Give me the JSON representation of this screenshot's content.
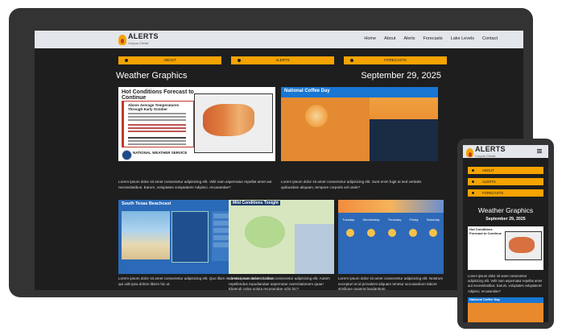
{
  "site": {
    "logo_title": "ALERTS",
    "logo_subtitle": "Corpus Christi",
    "nav": [
      "Home",
      "About",
      "Alerts",
      "Forecasts",
      "Lake Levels",
      "Contact"
    ]
  },
  "tabs": [
    "ABOUT",
    "ALERTS",
    "FORECASTS"
  ],
  "page": {
    "title": "Weather Graphics",
    "date": "September 29, 2025"
  },
  "cards": [
    {
      "heading": "Hot Conditions Forecast to Continue",
      "box_heading": "Above Average Temperatures Through Early October",
      "footer": "NATIONAL WEATHER SERVICE",
      "caption": "Lorem ipsum dolor sit amet consectetur adipisicing elit. Velit nam aspernatur repellat amet aut necessitatibus. Earum, voluptates voluptatem! Adipisci, recusandae?"
    },
    {
      "heading": "National Coffee Day",
      "caption": "Lorem ipsum dolor sit amet consectetur adipisicing elit. Sunt enim fugit at sed veritatis quibusdam aliquam, tempore corporis vel unde?"
    },
    {
      "heading": "South Texas Beachcast",
      "caption": "Lorem ipsum dolor sit amet consectetur adipisicing elit. Quo illum molestias cum necessitatibus qui odit ipsa dolore libero hic ut."
    },
    {
      "heading": "Mild Conditions Tonight",
      "caption": "Lorem ipsum dolor sit amet consectetur adipisicing elit. Autem repellendus repudiandae aspernatur exercitationem quae! Eligendi culpa soluta recusandae odio hic?"
    },
    {
      "heading": "",
      "days": [
        "Tuesday",
        "Wednesday",
        "Thursday",
        "Friday",
        "Saturday"
      ],
      "caption": "Lorem ipsum dolor sit amet consectetur adipisicing elit. Nostrum excepturi at id provident aliquam tenetur accusantium labore similique quaerat laudantium."
    }
  ],
  "mobile": {
    "card_heading": "Hot Conditions Forecast to Continue",
    "card2_heading": "National Coffee Day",
    "caption": "Lorem ipsum dolor sit amet consectetur adipisicing elit. Velit nam aspernatur repellat amet aut necessitatibus. Earum, voluptates voluptatem! Adipisci, recusandae?"
  }
}
